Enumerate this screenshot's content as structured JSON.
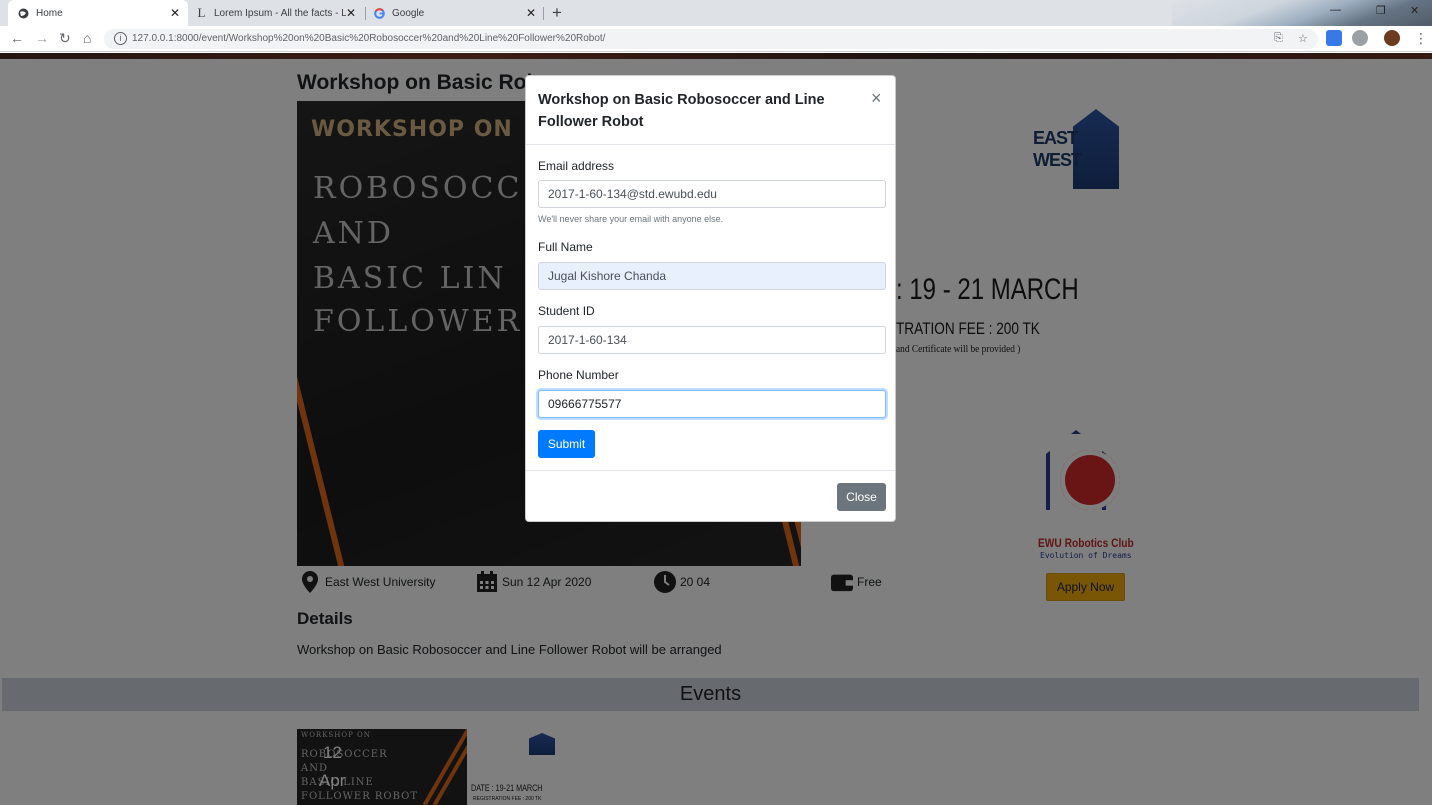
{
  "browser": {
    "tabs": [
      {
        "title": "Home",
        "icon": "globe-icon"
      },
      {
        "title": "Lorem Ipsum - All the facts - Lip",
        "icon": "L"
      },
      {
        "title": "Google",
        "icon": "G"
      }
    ],
    "new_tab": "+",
    "url": "127.0.0.1:8000/event/Workshop%20on%20Basic%20Robosoccer%20and%20Line%20Follower%20Robot/"
  },
  "event": {
    "title": "Workshop on Basic Robosoccer and Line Follower Robot",
    "title_visible": "Workshop on Basic Robo",
    "poster": {
      "heading": "WORKSHOP ON",
      "lines": [
        "ROBOSOCC",
        "AND",
        "BASIC LIN",
        "FOLLOWER"
      ],
      "date": ": 19 - 21 MARCH",
      "fee": "TRATION FEE : 200 TK",
      "certificate": "and Certificate will be provided )",
      "east_west_logo": "EAST WEST",
      "club_name": "EWU Robotics Club",
      "club_tagline": "Evolution of Dreams"
    },
    "location": "East West University",
    "date": "Sun 12 Apr 2020",
    "time": "20 04",
    "price": "Free",
    "apply_label": "Apply Now",
    "details_heading": "Details",
    "details_text": "Workshop on Basic Robosoccer and Line Follower Robot will be arranged"
  },
  "events_section": {
    "heading": "Events",
    "card": {
      "day": "12",
      "month": "Apr",
      "poster_lines": [
        "WORKSHOP ON",
        "ROBOSOCCER",
        "AND",
        "BASIC LINE",
        "FOLLOWER ROBOT"
      ],
      "date": "DATE : 19-21 MARCH",
      "fee": "REGISTRATION FEE : 200 TK"
    }
  },
  "modal": {
    "title": "Workshop on Basic Robosoccer and Line Follower Robot",
    "close_x": "×",
    "email_label": "Email address",
    "email_value": "2017-1-60-134@std.ewubd.edu",
    "email_help": "We'll never share your email with anyone else.",
    "name_label": "Full Name",
    "name_value": "Jugal Kishore Chanda",
    "id_label": "Student ID",
    "id_value": "2017-1-60-134",
    "phone_label": "Phone Number",
    "phone_value": "09666775577",
    "submit_label": "Submit",
    "close_label": "Close"
  },
  "colors": {
    "primary": "#007bff",
    "secondary": "#6c757d",
    "warning": "#f0ad0a",
    "backdrop": "rgba(0,0,0,0.5)"
  }
}
